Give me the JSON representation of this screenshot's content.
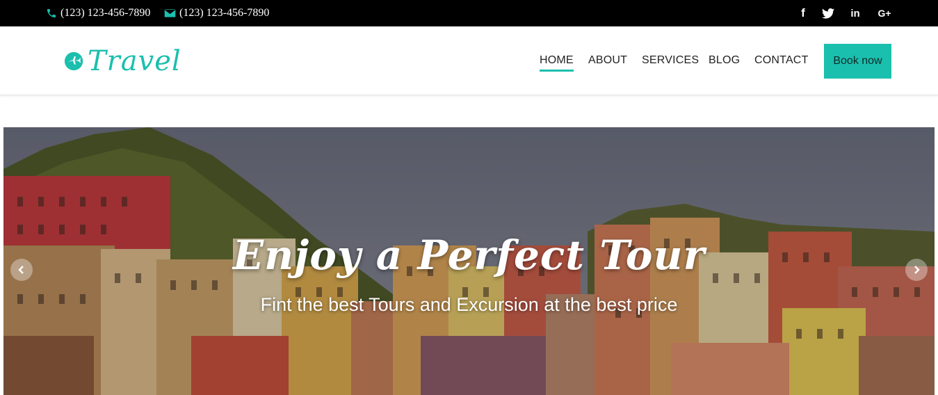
{
  "topbar": {
    "phone_1": "(123) 123-456-7890",
    "phone_2": "(123) 123-456-7890",
    "social": [
      "facebook-icon",
      "twitter-icon",
      "linkedin-icon",
      "google-plus-icon"
    ]
  },
  "header": {
    "logo_text": "Travel",
    "nav": {
      "home": "HOME",
      "about": "ABOUT",
      "services": "SERVICES",
      "blog": "BLOG",
      "contact": "CONTACT"
    },
    "book_label": "Book now"
  },
  "hero": {
    "title": "Enjoy a Perfect Tour",
    "subtitle": "Fint the best Tours and Excursion at the best price"
  },
  "colors": {
    "accent": "#1bbfae",
    "topbar_bg": "#000000"
  }
}
